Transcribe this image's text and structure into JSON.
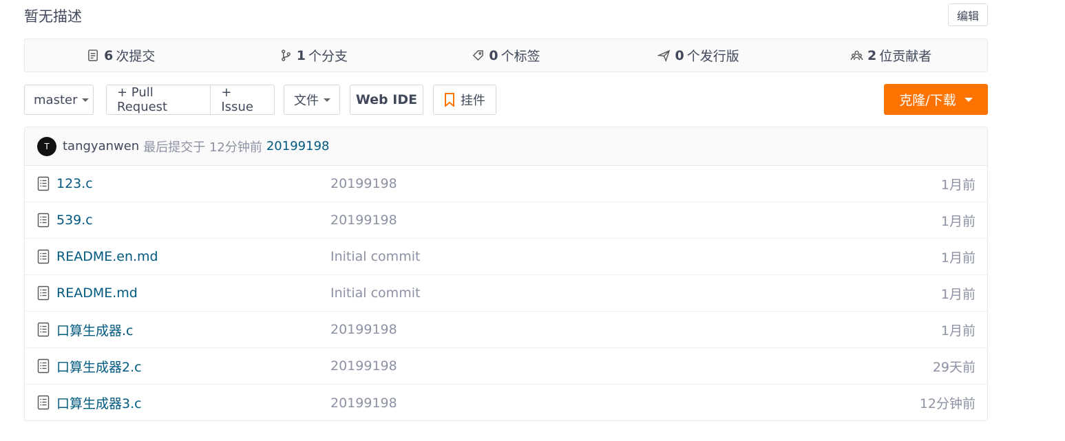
{
  "repo": {
    "description": "暂无描述",
    "edit_label": "编辑"
  },
  "stats": [
    {
      "icon": "commits-icon",
      "count": "6",
      "label": "次提交"
    },
    {
      "icon": "branch-icon",
      "count": "1",
      "label": "个分支"
    },
    {
      "icon": "tag-icon",
      "count": "0",
      "label": "个标签"
    },
    {
      "icon": "release-icon",
      "count": "0",
      "label": "个发行版"
    },
    {
      "icon": "contributors-icon",
      "count": "2",
      "label": "位贡献者"
    }
  ],
  "toolbar": {
    "branch": "master",
    "pull_request": "+ Pull Request",
    "issue": "+ Issue",
    "file": "文件",
    "web_ide": "Web IDE",
    "widget": "挂件",
    "clone": "克隆/下载",
    "accent": "#fe7300"
  },
  "last_commit": {
    "avatar_letter": "T",
    "author": "tangyanwen",
    "note": "最后提交于 12分钟前",
    "message": "20199198"
  },
  "files": [
    {
      "name": "123.c",
      "message": "20199198",
      "time": "1月前"
    },
    {
      "name": "539.c",
      "message": "20199198",
      "time": "1月前"
    },
    {
      "name": "README.en.md",
      "message": "Initial commit",
      "time": "1月前"
    },
    {
      "name": "README.md",
      "message": "Initial commit",
      "time": "1月前"
    },
    {
      "name": "口算生成器.c",
      "message": "20199198",
      "time": "1月前"
    },
    {
      "name": "口算生成器2.c",
      "message": "20199198",
      "time": "29天前"
    },
    {
      "name": "口算生成器3.c",
      "message": "20199198",
      "time": "12分钟前"
    }
  ]
}
